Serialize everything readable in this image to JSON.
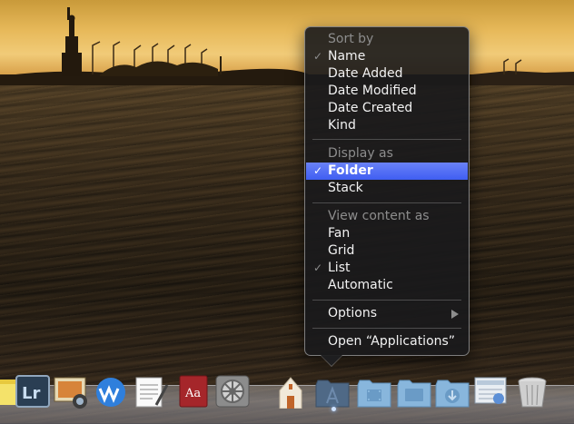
{
  "context_menu": {
    "sort_by": {
      "header": "Sort by",
      "items": [
        {
          "label": "Name",
          "checked": true
        },
        {
          "label": "Date Added",
          "checked": false
        },
        {
          "label": "Date Modified",
          "checked": false
        },
        {
          "label": "Date Created",
          "checked": false
        },
        {
          "label": "Kind",
          "checked": false
        }
      ]
    },
    "display_as": {
      "header": "Display as",
      "items": [
        {
          "label": "Folder",
          "checked": true,
          "highlighted": true
        },
        {
          "label": "Stack",
          "checked": false
        }
      ]
    },
    "view_content_as": {
      "header": "View content as",
      "items": [
        {
          "label": "Fan",
          "checked": false
        },
        {
          "label": "Grid",
          "checked": false
        },
        {
          "label": "List",
          "checked": true
        },
        {
          "label": "Automatic",
          "checked": false
        }
      ]
    },
    "options_label": "Options",
    "open_label": "Open “Applications”",
    "check_glyph": "✓",
    "highlight_color": "#3f5ef2"
  },
  "dock": {
    "items": [
      {
        "name": "stickies",
        "icon": "stickies-icon"
      },
      {
        "name": "Lightroom",
        "icon": "lightroom-icon",
        "text": "Lr"
      },
      {
        "name": "iPhoto",
        "icon": "iphoto-icon"
      },
      {
        "name": "Microsoft Word",
        "icon": "word-icon"
      },
      {
        "name": "TextEdit",
        "icon": "textedit-icon"
      },
      {
        "name": "Dictionary",
        "icon": "dictionary-icon",
        "text": "Aa"
      },
      {
        "name": "System Preferences",
        "icon": "system-preferences-icon"
      },
      {
        "name": "Home",
        "icon": "home-folder-icon"
      },
      {
        "name": "Applications",
        "icon": "applications-folder-icon",
        "active": true
      },
      {
        "name": "Movies",
        "icon": "movies-folder-icon"
      },
      {
        "name": "Desktop",
        "icon": "desktop-folder-icon"
      },
      {
        "name": "Downloads",
        "icon": "downloads-folder-icon"
      },
      {
        "name": "Documents Stack",
        "icon": "document-stack-icon"
      },
      {
        "name": "Trash",
        "icon": "trash-icon"
      }
    ]
  }
}
